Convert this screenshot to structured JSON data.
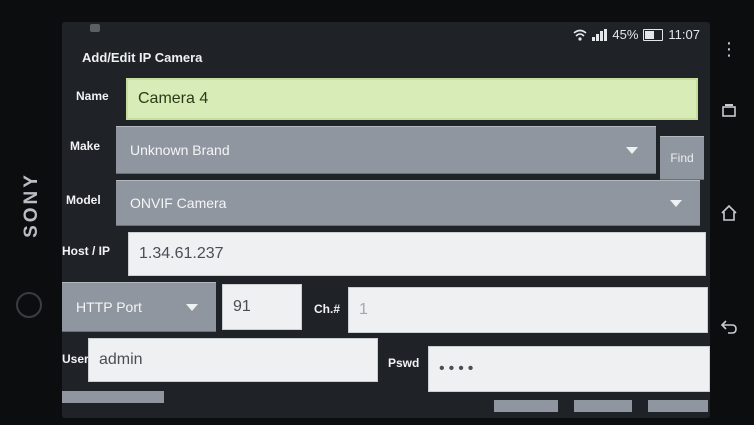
{
  "device": {
    "brand": "SONY"
  },
  "status_bar": {
    "battery_percent": "45%",
    "time": "11:07"
  },
  "app": {
    "title": "Add/Edit IP Camera"
  },
  "form": {
    "name": {
      "label": "Name",
      "value": "Camera 4"
    },
    "make": {
      "label": "Make",
      "value": "Unknown Brand",
      "find_label": "Find"
    },
    "model": {
      "label": "Model",
      "value": "ONVIF Camera"
    },
    "host": {
      "label": "Host / IP",
      "value": "1.34.61.237"
    },
    "port": {
      "select_value": "HTTP Port",
      "value": "91"
    },
    "channel": {
      "label": "Ch.#",
      "placeholder": "1"
    },
    "user": {
      "label": "User",
      "value": "admin"
    },
    "password": {
      "label": "Pswd",
      "masked_value": "••••"
    }
  },
  "icons": {
    "wifi": "wifi-icon",
    "signal": "signal-icon",
    "battery": "battery-icon",
    "overflow": "overflow-menu-icon",
    "recent": "recent-apps-icon",
    "home": "home-icon",
    "back": "back-icon"
  },
  "colors": {
    "name_field_bg": "#d8ecb7",
    "select_bg": "#9096a0",
    "input_bg": "#eef0f2",
    "screen_bg": "#1f2227"
  }
}
